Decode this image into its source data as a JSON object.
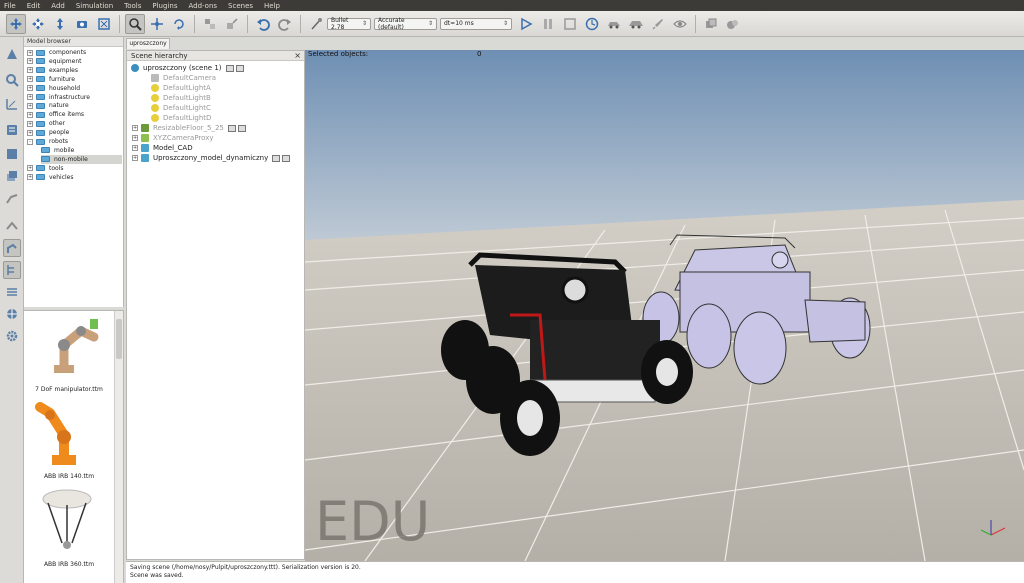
{
  "menu": [
    "File",
    "Edit",
    "Add",
    "Simulation",
    "Tools",
    "Plugins",
    "Add-ons",
    "Scenes",
    "Help"
  ],
  "toolbar": {
    "engine": "Bullet 2.78",
    "accuracy": "Accurate (default)",
    "timestep": "dt=10 ms"
  },
  "model_browser": {
    "title": "Model browser",
    "items": [
      {
        "label": "components",
        "expander": "+"
      },
      {
        "label": "equipment",
        "expander": "+"
      },
      {
        "label": "examples",
        "expander": "+"
      },
      {
        "label": "furniture",
        "expander": "+"
      },
      {
        "label": "household",
        "expander": "+"
      },
      {
        "label": "infrastructure",
        "expander": "+"
      },
      {
        "label": "nature",
        "expander": "+"
      },
      {
        "label": "office items",
        "expander": "+"
      },
      {
        "label": "other",
        "expander": "+"
      },
      {
        "label": "people",
        "expander": "+"
      },
      {
        "label": "robots",
        "expander": "-"
      },
      {
        "label": "mobile",
        "expander": ""
      },
      {
        "label": "non-mobile",
        "expander": ""
      },
      {
        "label": "tools",
        "expander": "+"
      },
      {
        "label": "vehicles",
        "expander": "+"
      }
    ]
  },
  "thumbnails": [
    {
      "label": "7 DoF manipulator.ttm"
    },
    {
      "label": "ABB IRB 140.ttm"
    },
    {
      "label": "ABB IRB 360.ttm"
    }
  ],
  "scene_tab": "uproszczony",
  "scene_hierarchy": {
    "title": "Scene hierarchy",
    "close": "×",
    "items": [
      {
        "label": "uproszczony (scene 1)",
        "expander": ""
      },
      {
        "label": "DefaultCamera",
        "expander": ""
      },
      {
        "label": "DefaultLightA",
        "expander": ""
      },
      {
        "label": "DefaultLightB",
        "expander": ""
      },
      {
        "label": "DefaultLightC",
        "expander": ""
      },
      {
        "label": "DefaultLightD",
        "expander": ""
      },
      {
        "label": "ResizableFloor_5_25",
        "expander": "+"
      },
      {
        "label": "XYZCameraProxy",
        "expander": "+"
      },
      {
        "label": "Model_CAD",
        "expander": "+"
      },
      {
        "label": "Uproszczony_model_dynamiczny",
        "expander": "+"
      }
    ]
  },
  "viewport": {
    "selected_label": "Selected objects:",
    "selected_count": "0",
    "watermark": "EDU"
  },
  "status": {
    "line1": "Saving scene (/home/nosy/Pulpit/uproszczony.ttt). Serialization version is 20.",
    "line2": "Scene was saved."
  },
  "colors": {
    "menubar": "#3c3b37",
    "folder": "#5fa9d9",
    "sky_top": "#5f7fa3",
    "floor": "#c3beb4"
  }
}
